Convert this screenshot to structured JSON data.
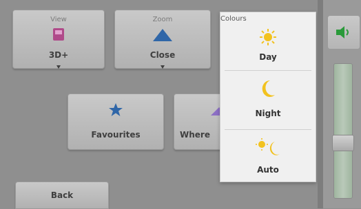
{
  "buttons": {
    "view": {
      "caption": "View",
      "label": "3D+"
    },
    "zoom": {
      "caption": "Zoom",
      "label": "Close"
    },
    "favourites": {
      "label": "Favourites"
    },
    "where": {
      "label": "Where"
    },
    "back": {
      "label": "Back"
    }
  },
  "colours_popup": {
    "caption": "Colours",
    "items": [
      {
        "label": "Day",
        "icon": "sun-icon"
      },
      {
        "label": "Night",
        "icon": "moon-icon"
      },
      {
        "label": "Auto",
        "icon": "sun-moon-icon"
      }
    ]
  },
  "volume": {
    "level": 0.4,
    "icon": "speaker-icon"
  }
}
